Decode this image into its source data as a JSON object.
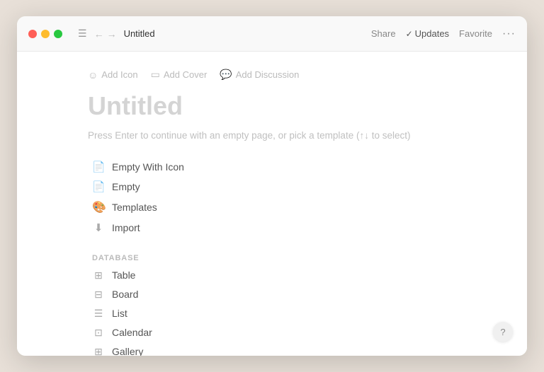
{
  "window": {
    "title": "Untitled"
  },
  "titlebar": {
    "traffic_lights": [
      "close",
      "minimize",
      "maximize"
    ],
    "nav_back": "←",
    "nav_forward": "→",
    "page_title": "Untitled",
    "actions": {
      "share": "Share",
      "updates": "Updates",
      "favorite": "Favorite",
      "more": "···"
    }
  },
  "meta_actions": [
    {
      "icon": "☺",
      "label": "Add Icon"
    },
    {
      "icon": "🖼",
      "label": "Add Cover"
    },
    {
      "icon": "💬",
      "label": "Add Discussion"
    }
  ],
  "page": {
    "heading": "Untitled",
    "hint": "Press Enter to continue with an empty page, or pick a template (↑↓ to select)"
  },
  "template_items": [
    {
      "icon": "📄",
      "label": "Empty With Icon",
      "colorful": false
    },
    {
      "icon": "📄",
      "label": "Empty",
      "colorful": false
    },
    {
      "icon": "🎨",
      "label": "Templates",
      "colorful": true
    },
    {
      "icon": "⬇",
      "label": "Import",
      "colorful": false
    }
  ],
  "database_section": {
    "label": "DATABASE",
    "items": [
      {
        "icon": "⊞",
        "label": "Table"
      },
      {
        "icon": "⊟",
        "label": "Board"
      },
      {
        "icon": "☰",
        "label": "List"
      },
      {
        "icon": "⊡",
        "label": "Calendar"
      },
      {
        "icon": "⊞",
        "label": "Gallery"
      }
    ]
  },
  "help": "?"
}
